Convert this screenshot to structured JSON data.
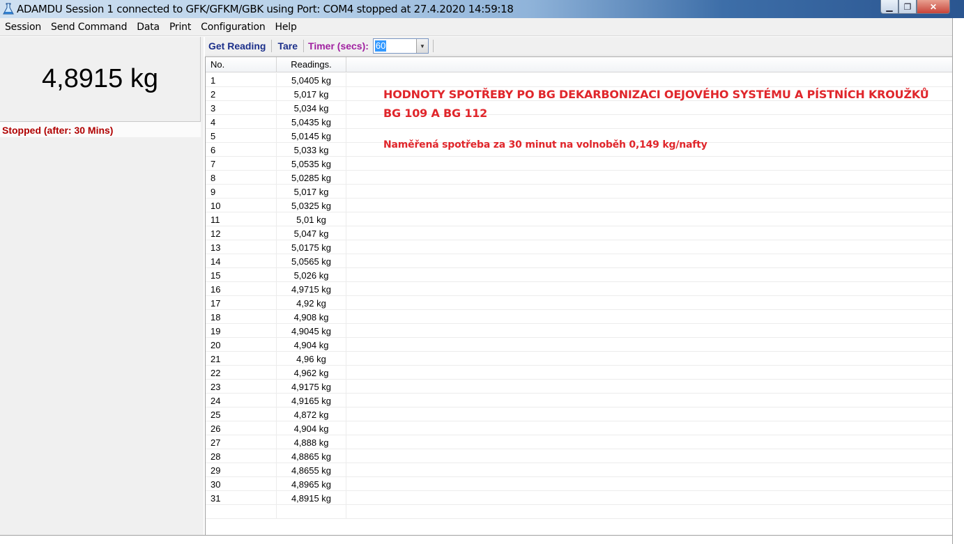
{
  "window": {
    "title": "ADAMDU Session 1 connected to GFK/GFKM/GBK using Port: COM4 stopped at 27.4.2020 14:59:18",
    "minimize_glyph": "▁",
    "maximize_glyph": "❐",
    "close_glyph": "✕"
  },
  "menu": [
    "Session",
    "Send Command",
    "Data",
    "Print",
    "Configuration",
    "Help"
  ],
  "display": {
    "weight": "4,8915 kg",
    "status": "Stopped (after: 30 Mins)"
  },
  "toolbar": {
    "get_reading": "Get Reading",
    "tare": "Tare",
    "timer_label": "Timer (secs):",
    "timer_value": "60",
    "dropdown_glyph": "▼"
  },
  "table": {
    "headers": {
      "no": "No.",
      "readings": "Readings."
    },
    "rows": [
      {
        "no": "1",
        "reading": "5,0405 kg"
      },
      {
        "no": "2",
        "reading": "5,017 kg"
      },
      {
        "no": "3",
        "reading": "5,034 kg"
      },
      {
        "no": "4",
        "reading": "5,0435 kg"
      },
      {
        "no": "5",
        "reading": "5,0145 kg"
      },
      {
        "no": "6",
        "reading": "5,033 kg"
      },
      {
        "no": "7",
        "reading": "5,0535 kg"
      },
      {
        "no": "8",
        "reading": "5,0285 kg"
      },
      {
        "no": "9",
        "reading": "5,017 kg"
      },
      {
        "no": "10",
        "reading": "5,0325 kg"
      },
      {
        "no": "11",
        "reading": "5,01 kg"
      },
      {
        "no": "12",
        "reading": "5,047 kg"
      },
      {
        "no": "13",
        "reading": "5,0175 kg"
      },
      {
        "no": "14",
        "reading": "5,0565 kg"
      },
      {
        "no": "15",
        "reading": "5,026 kg"
      },
      {
        "no": "16",
        "reading": "4,9715 kg"
      },
      {
        "no": "17",
        "reading": "4,92 kg"
      },
      {
        "no": "18",
        "reading": "4,908 kg"
      },
      {
        "no": "19",
        "reading": "4,9045 kg"
      },
      {
        "no": "20",
        "reading": "4,904 kg"
      },
      {
        "no": "21",
        "reading": "4,96 kg"
      },
      {
        "no": "22",
        "reading": "4,962 kg"
      },
      {
        "no": "23",
        "reading": "4,9175 kg"
      },
      {
        "no": "24",
        "reading": "4,9165 kg"
      },
      {
        "no": "25",
        "reading": "4,872 kg"
      },
      {
        "no": "26",
        "reading": "4,904 kg"
      },
      {
        "no": "27",
        "reading": "4,888 kg"
      },
      {
        "no": "28",
        "reading": "4,8865 kg"
      },
      {
        "no": "29",
        "reading": "4,8655 kg"
      },
      {
        "no": "30",
        "reading": "4,8965 kg"
      },
      {
        "no": "31",
        "reading": "4,8915 kg"
      },
      {
        "no": "",
        "reading": ""
      }
    ]
  },
  "annotation": {
    "line1": "HODNOTY SPOTŘEBY PO BG DEKARBONIZACI OEJOVÉHO SYSTÉMU A PÍSTNÍCH KROUŽKŮ",
    "line2": "BG 109 A BG 112",
    "line3": "Naměřená spotřeba za 30 minut na volnoběh 0,149 kg/nafty"
  },
  "colors": {
    "annotation": "#e0262b",
    "status": "#b00000",
    "toolbar_button": "#1b2f8a",
    "timer_label": "#a020a0"
  }
}
